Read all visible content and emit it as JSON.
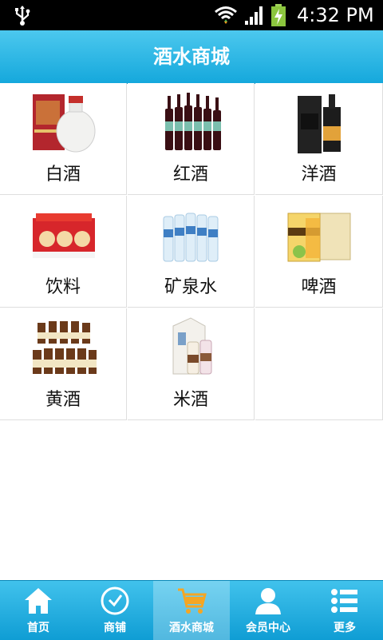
{
  "status_bar": {
    "time": "4:32 PM",
    "icons": [
      "usb-icon",
      "wifi-icon",
      "signal-icon",
      "battery-charging-icon"
    ]
  },
  "header": {
    "title": "酒水商城",
    "color": "#1aaee0"
  },
  "categories": [
    {
      "label": "白酒",
      "icon": "baijiu-product-image"
    },
    {
      "label": "红酒",
      "icon": "red-wine-product-image"
    },
    {
      "label": "洋酒",
      "icon": "whisky-product-image"
    },
    {
      "label": "饮料",
      "icon": "beverage-product-image"
    },
    {
      "label": "矿泉水",
      "icon": "mineral-water-product-image"
    },
    {
      "label": "啤酒",
      "icon": "beer-product-image"
    },
    {
      "label": "黄酒",
      "icon": "yellow-wine-product-image"
    },
    {
      "label": "米酒",
      "icon": "rice-wine-product-image"
    }
  ],
  "nav": {
    "active_index": 2,
    "items": [
      {
        "label": "首页",
        "icon": "home-icon"
      },
      {
        "label": "商铺",
        "icon": "clock-icon"
      },
      {
        "label": "酒水商城",
        "icon": "shopping-cart-icon"
      },
      {
        "label": "会员中心",
        "icon": "user-icon"
      },
      {
        "label": "更多",
        "icon": "list-icon"
      }
    ]
  }
}
